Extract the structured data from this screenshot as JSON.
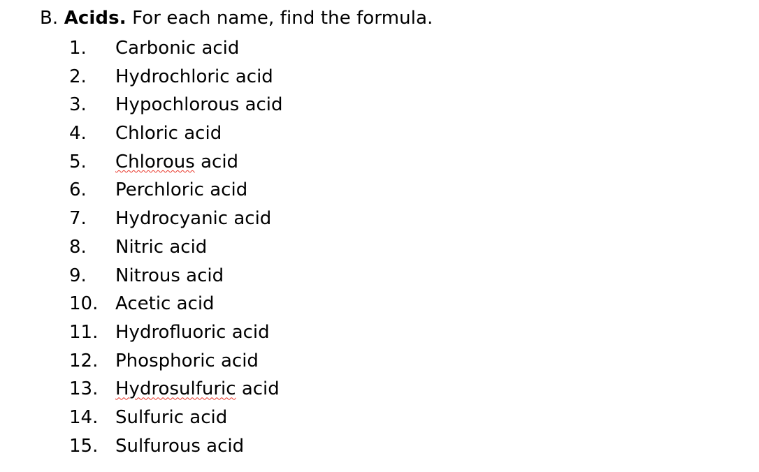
{
  "document": {
    "background_color": "#ffffff",
    "text_color": "#000000",
    "spellcheck_underline_color": "#e8372b"
  },
  "heading": {
    "section_letter": "B.",
    "section_title": "Acids.",
    "instruction": "For each name, find the formula.",
    "full_text": "B. Acids. For each name, find the formula."
  },
  "list": {
    "items": [
      {
        "number": "1.",
        "name": "Carbonic acid",
        "misspelled_word": "",
        "rest": "Carbonic acid"
      },
      {
        "number": "2.",
        "name": "Hydrochloric acid",
        "misspelled_word": "",
        "rest": "Hydrochloric acid"
      },
      {
        "number": "3.",
        "name": "Hypochlorous acid",
        "misspelled_word": "",
        "rest": "Hypochlorous acid"
      },
      {
        "number": "4.",
        "name": "Chloric acid",
        "misspelled_word": "",
        "rest": "Chloric acid"
      },
      {
        "number": "5.",
        "name": "Chlorous acid",
        "misspelled_word": "Chlorous",
        "rest": " acid"
      },
      {
        "number": "6.",
        "name": "Perchloric acid",
        "misspelled_word": "",
        "rest": "Perchloric acid"
      },
      {
        "number": "7.",
        "name": "Hydrocyanic acid",
        "misspelled_word": "",
        "rest": "Hydrocyanic acid"
      },
      {
        "number": "8.",
        "name": "Nitric acid",
        "misspelled_word": "",
        "rest": "Nitric acid"
      },
      {
        "number": "9.",
        "name": "Nitrous acid",
        "misspelled_word": "",
        "rest": "Nitrous acid"
      },
      {
        "number": "10.",
        "name": "Acetic acid",
        "misspelled_word": "",
        "rest": "Acetic acid"
      },
      {
        "number": "11.",
        "name": "Hydrofluoric acid",
        "misspelled_word": "",
        "rest": "Hydrofluoric acid"
      },
      {
        "number": "12.",
        "name": "Phosphoric acid",
        "misspelled_word": "",
        "rest": "Phosphoric acid"
      },
      {
        "number": "13.",
        "name": "Hydrosulfuric acid",
        "misspelled_word": "Hydrosulfuric",
        "rest": " acid"
      },
      {
        "number": "14.",
        "name": "Sulfuric acid",
        "misspelled_word": "",
        "rest": "Sulfuric acid"
      },
      {
        "number": "15.",
        "name": "Sulfurous acid",
        "misspelled_word": "",
        "rest": "Sulfurous acid"
      }
    ]
  }
}
